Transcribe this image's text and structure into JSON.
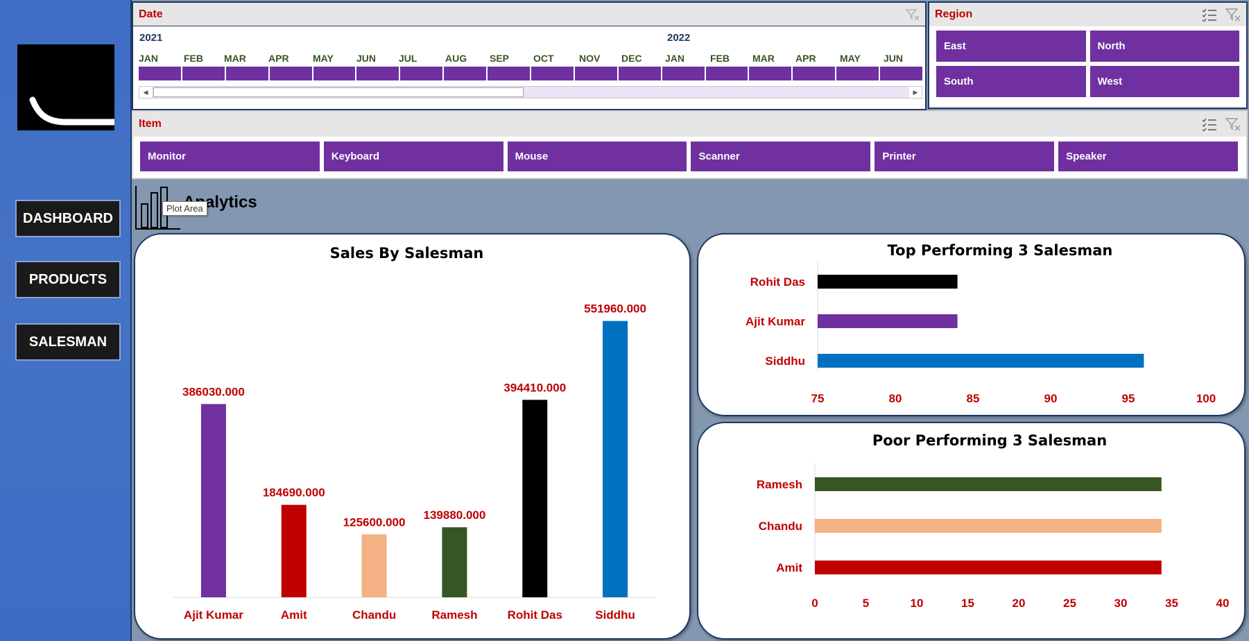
{
  "nav": {
    "buttons": [
      "DASHBOARD",
      "PRODUCTS",
      "SALESMAN"
    ]
  },
  "date_slicer": {
    "title": "Date",
    "years": [
      "2021",
      "2022"
    ],
    "months": [
      "JAN",
      "FEB",
      "MAR",
      "APR",
      "MAY",
      "JUN",
      "JUL",
      "AUG",
      "SEP",
      "OCT",
      "NOV",
      "DEC",
      "JAN",
      "FEB",
      "MAR",
      "APR",
      "MAY",
      "JUN"
    ]
  },
  "region_slicer": {
    "title": "Region",
    "items": [
      "East",
      "North",
      "South",
      "West"
    ]
  },
  "item_slicer": {
    "title": "Item",
    "items": [
      "Monitor",
      "Keyboard",
      "Mouse",
      "Scanner",
      "Printer",
      "Speaker"
    ]
  },
  "analytics": {
    "title": "Analytics",
    "tooltip": "Plot Area"
  },
  "colors": {
    "slicer_purple": "#7030a0",
    "label_red": "#c00000",
    "nav_blue": "#4472c4"
  },
  "chart_data": [
    {
      "type": "bar",
      "title": "Sales By Salesman",
      "categories": [
        "Ajit Kumar",
        "Amit",
        "Chandu",
        "Ramesh",
        "Rohit Das",
        "Siddhu"
      ],
      "values": [
        386030,
        184690,
        125600,
        139880,
        394410,
        551960
      ],
      "data_labels": [
        "386030.000",
        "184690.000",
        "125600.000",
        "139880.000",
        "394410.000",
        "551960.000"
      ],
      "colors": [
        "#7030a0",
        "#c00000",
        "#f4b183",
        "#375623",
        "#000000",
        "#0070c0"
      ],
      "ylim": [
        0,
        600000
      ],
      "grid": false
    },
    {
      "type": "bar",
      "orientation": "horizontal",
      "title": "Top Performing 3 Salesman",
      "categories": [
        "Rohit Das",
        "Ajit Kumar",
        "Siddhu"
      ],
      "values": [
        84,
        84,
        96
      ],
      "colors": [
        "#000000",
        "#7030a0",
        "#0070c0"
      ],
      "xlim": [
        75,
        100
      ],
      "xticks": [
        "75",
        "80",
        "85",
        "90",
        "95",
        "100"
      ]
    },
    {
      "type": "bar",
      "orientation": "horizontal",
      "title": "Poor Performing 3 Salesman",
      "categories": [
        "Ramesh",
        "Chandu",
        "Amit"
      ],
      "values": [
        34,
        34,
        34
      ],
      "colors": [
        "#375623",
        "#f4b183",
        "#c00000"
      ],
      "xlim": [
        0,
        40
      ],
      "xticks": [
        "0",
        "5",
        "10",
        "15",
        "20",
        "25",
        "30",
        "35",
        "40"
      ]
    }
  ]
}
